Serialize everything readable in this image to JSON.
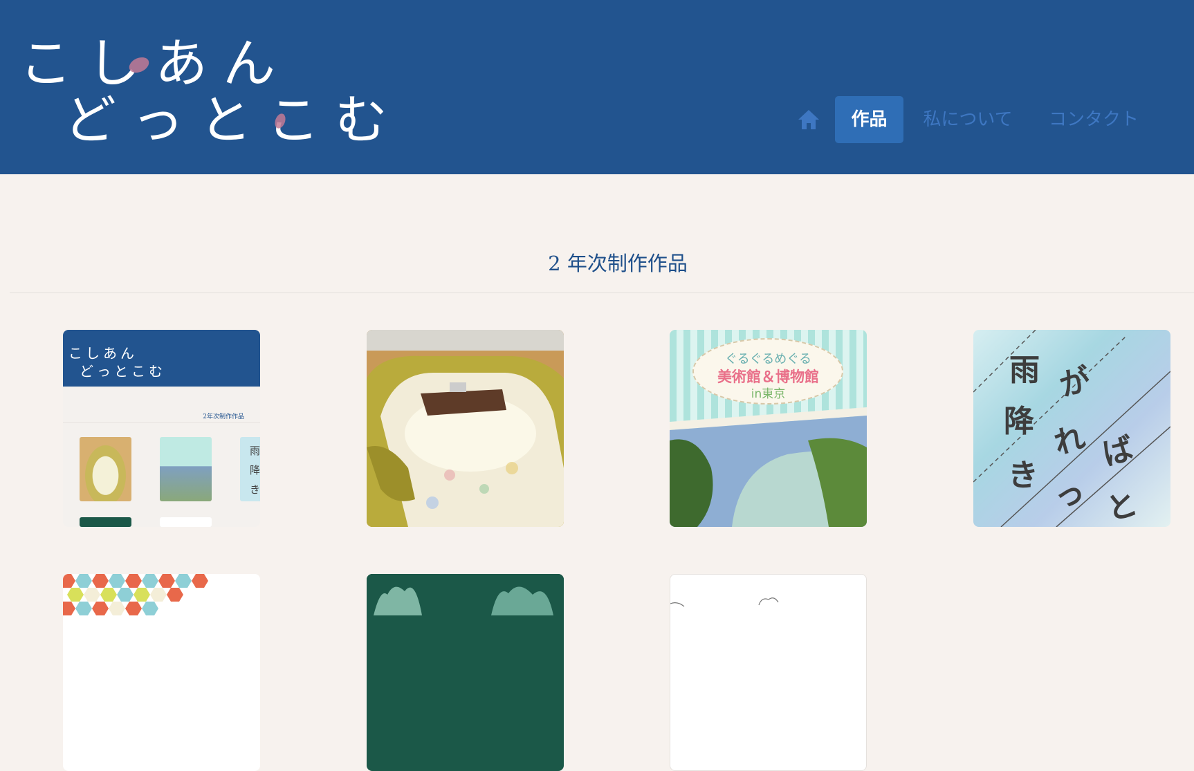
{
  "header": {
    "logo_line1": "こしあん",
    "logo_line2": "どっとこむ",
    "colors": {
      "background": "#22548f",
      "accent": "#2f6eb6",
      "logo_dot": "#c27a95"
    }
  },
  "nav": {
    "home_icon": "home-icon",
    "items": [
      {
        "label": "作品",
        "active": true
      },
      {
        "label": "私について",
        "active": false
      },
      {
        "label": "コンタクト",
        "active": false
      }
    ]
  },
  "main": {
    "section_title": "2 年次制作作品",
    "cards": [
      {
        "thumb_mini_logo_line1": "こしあん",
        "thumb_mini_logo_line2": "どっとこむ",
        "thumb_mini_title": "2年次制作作品",
        "thumb_mini_rain": "雨降き"
      },
      {},
      {
        "line1": "ぐるぐるめぐる",
        "line2": "美術館＆博物館",
        "line3": "in東京"
      },
      {
        "chars": [
          "雨",
          "が",
          "降",
          "れ",
          "ば",
          "き",
          "っ",
          "と"
        ]
      },
      {},
      {},
      {}
    ]
  }
}
